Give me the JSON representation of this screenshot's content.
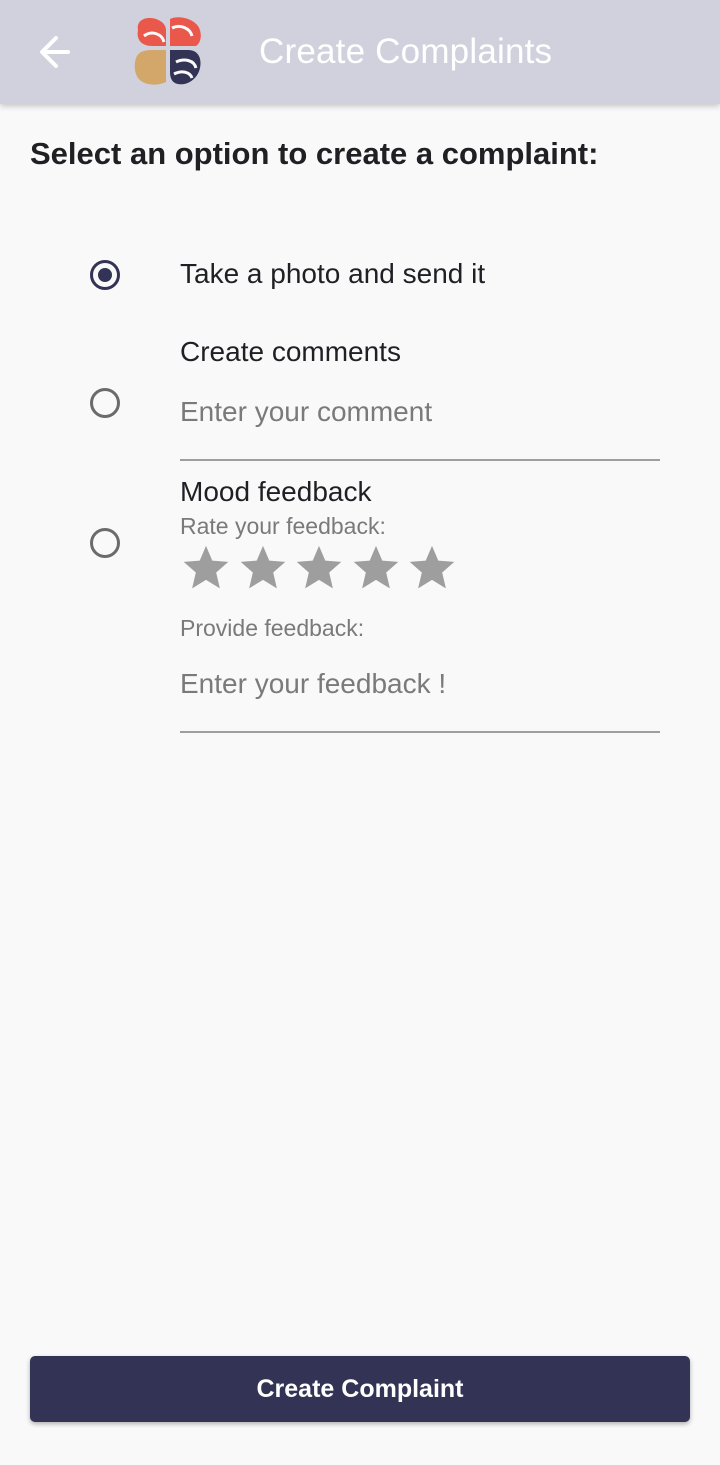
{
  "appbar": {
    "title": "Create Complaints",
    "back_icon": "arrow-left-icon",
    "logo": "app-logo"
  },
  "instruction": "Select an option to create a complaint:",
  "options": [
    {
      "label": "Take a photo and send it",
      "selected": true
    },
    {
      "label": "Create comments",
      "selected": false,
      "input_value": "",
      "input_placeholder": "Enter your comment"
    },
    {
      "label": "Mood feedback",
      "selected": false,
      "rating_label": "Rate your feedback:",
      "rating_value": 0,
      "rating_max": 5,
      "provide_label": "Provide  feedback:",
      "input_value": "",
      "input_placeholder": "Enter your feedback !"
    }
  ],
  "submit_label": "Create Complaint",
  "colors": {
    "appbar_bg": "#d1d1de",
    "primary": "#333355",
    "background": "#f9f9fa",
    "star_empty": "#9e9e9e",
    "logo_coral": "#e9584a",
    "logo_gold": "#d3a669",
    "logo_navy": "#333355"
  }
}
